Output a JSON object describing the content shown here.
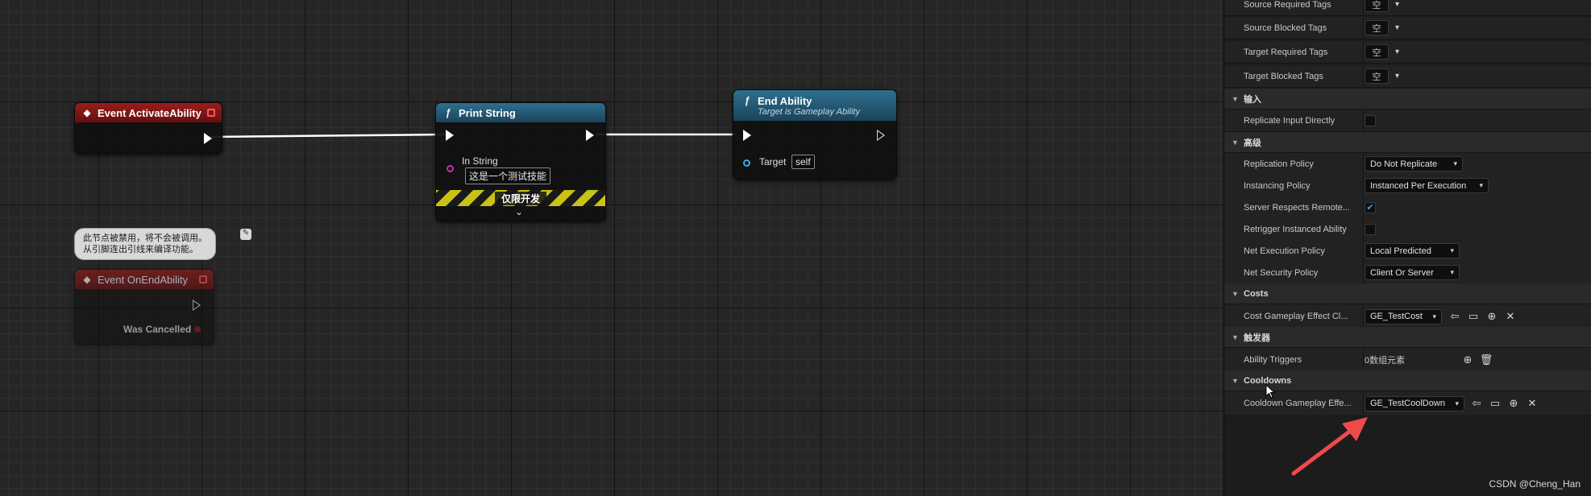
{
  "graph": {
    "nodes": {
      "activate": {
        "title": "Event ActivateAbility"
      },
      "print": {
        "title": "Print String",
        "in_string_label": "In String",
        "in_string_value": "这是一个测试技能",
        "dev_only_label": "仅限开发"
      },
      "end": {
        "title": "End Ability",
        "subtitle": "Target is Gameplay Ability",
        "target_label": "Target",
        "target_value": "self"
      },
      "on_end": {
        "title": "Event OnEndAbility",
        "was_cancelled_label": "Was Cancelled"
      }
    },
    "disabled_tooltip": {
      "line1": "此节点被禁用，将不会被调用。",
      "line2": "从引脚连出引线来编译功能。"
    }
  },
  "details": {
    "tag_rows": [
      {
        "label": "Source Required Tags",
        "value": "空"
      },
      {
        "label": "Source Blocked Tags",
        "value": "空"
      },
      {
        "label": "Target Required Tags",
        "value": "空"
      },
      {
        "label": "Target Blocked Tags",
        "value": "空"
      }
    ],
    "sections": {
      "input": "输入",
      "advanced": "高级",
      "costs": "Costs",
      "triggers": "触发器",
      "cooldowns": "Cooldowns"
    },
    "input_rows": {
      "replicate_input": {
        "label": "Replicate Input Directly",
        "checked": false
      }
    },
    "advanced_rows": {
      "replication_policy": {
        "label": "Replication Policy",
        "value": "Do Not Replicate"
      },
      "instancing_policy": {
        "label": "Instancing Policy",
        "value": "Instanced Per Execution"
      },
      "server_respects": {
        "label": "Server Respects Remote...",
        "checked": true
      },
      "retrigger": {
        "label": "Retrigger Instanced Ability",
        "checked": false
      },
      "net_exec_policy": {
        "label": "Net Execution Policy",
        "value": "Local Predicted"
      },
      "net_security_policy": {
        "label": "Net Security Policy",
        "value": "Client Or Server"
      }
    },
    "costs_rows": {
      "cost_ge": {
        "label": "Cost Gameplay Effect Cl...",
        "value": "GE_TestCost"
      }
    },
    "trigger_rows": {
      "ability_triggers": {
        "label": "Ability Triggers",
        "value": "0数组元素"
      }
    },
    "cooldown_rows": {
      "cooldown_ge": {
        "label": "Cooldown Gameplay Effe...",
        "value": "GE_TestCoolDown"
      }
    }
  },
  "watermark": "CSDN @Cheng_Han",
  "colors": {
    "event_header": "#9b1c1c",
    "function_header": "#2e6f8f",
    "annotation_arrow": "#ef4a4a",
    "check_accent": "#3aa0ff"
  }
}
